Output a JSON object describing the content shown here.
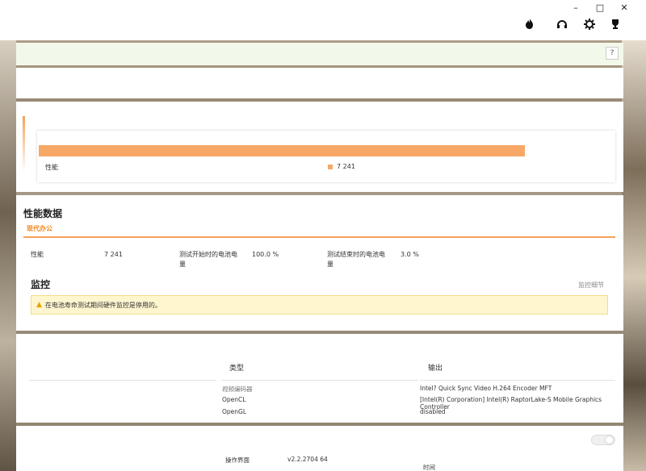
{
  "window": {
    "minimize": "–",
    "maximize": "□",
    "close": "✕"
  },
  "header_icons": [
    "fire-icon",
    "headset-icon",
    "gear-icon",
    "trophy-icon"
  ],
  "alert_bar": {
    "help_label": "?"
  },
  "chart": {
    "series_label": "性能",
    "legend_value": "7 241",
    "fill_fraction": 0.99,
    "color": "#f7a866"
  },
  "perf": {
    "title": "性能数据",
    "active_tab": "现代办公",
    "rows": [
      {
        "label": "性能",
        "value": "7 241"
      },
      {
        "label": "测试开始时的电池电量",
        "value": "100.0 %"
      },
      {
        "label": "测试结束时的电池电量",
        "value": "3.0 %"
      }
    ],
    "monitor_title": "监控",
    "monitor_link": "监控细节",
    "warning": "在电池寿命测试期间硬件监控是停用的。"
  },
  "table": {
    "headers": {
      "type": "类型",
      "output": "输出"
    },
    "rows": [
      {
        "type": "视频编码器",
        "output": "Intel? Quick Sync Video H.264 Encoder MFT"
      },
      {
        "type": "OpenCL",
        "output": "[Intel(R) Corporation] Intel(R) RaptorLake-S Mobile Graphics Controller"
      },
      {
        "type": "OpenGL",
        "output": "disabled"
      }
    ]
  },
  "footer": {
    "ui_label": "操作界面",
    "ui_value": "v2.2.2704 64",
    "time_label": "时间"
  },
  "colors": {
    "accent": "#f4a259",
    "tab_text": "#f08a24",
    "warning_bg": "#fff6cf"
  }
}
